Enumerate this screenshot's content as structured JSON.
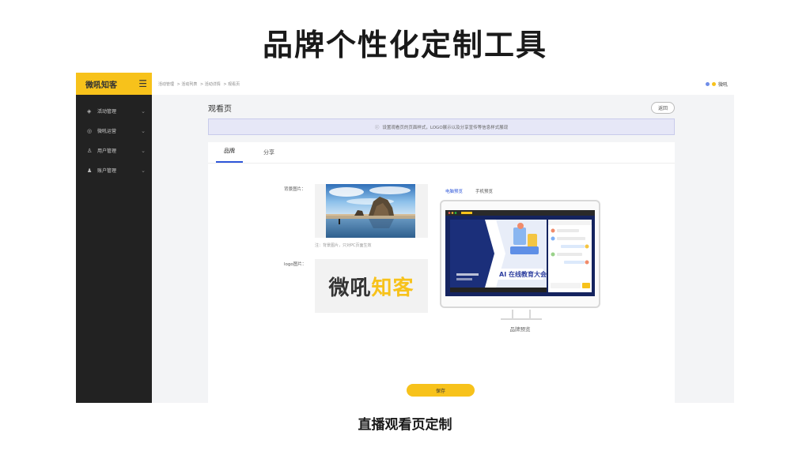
{
  "slide": {
    "title": "品牌个性化定制工具",
    "caption": "直播观看页定制"
  },
  "sidebar": {
    "brand": "微吼知客",
    "menu_icon": "hamburger-icon",
    "items": [
      {
        "label": "活动管理",
        "icon": "layers-icon"
      },
      {
        "label": "微吼运营",
        "icon": "chat-icon"
      },
      {
        "label": "用户管理",
        "icon": "user-icon"
      },
      {
        "label": "账户管理",
        "icon": "account-icon"
      }
    ]
  },
  "topbar": {
    "breadcrumbs": [
      "活动管理",
      "> 活动列表",
      "> 活动详情",
      "> 观看页"
    ],
    "username": "微吼"
  },
  "page": {
    "title": "观看页",
    "back_label": "返回",
    "notice": "设置观看页的页面样式，LOGO展示以及分享宣传等信息样式展现"
  },
  "tabs": [
    {
      "label": "品牌",
      "active": true
    },
    {
      "label": "分享",
      "active": false
    }
  ],
  "form": {
    "bg_label": "背景图片：",
    "bg_note": "注：背景图片，只对PC页面生效",
    "logo_label": "logo图片：",
    "logo_text_a": "微吼",
    "logo_text_b": "知客"
  },
  "preview": {
    "tabs": [
      {
        "label": "电脑预览",
        "active": true
      },
      {
        "label": "手机预览",
        "active": false
      }
    ],
    "caption": "品牌预览",
    "screen_banner": "AI 在线教育大会"
  },
  "actions": {
    "save_label": "保存"
  },
  "colors": {
    "accent": "#f7c21b",
    "sidebar": "#222222",
    "link": "#2e56d9",
    "notice_bg": "#e6e7f7"
  }
}
